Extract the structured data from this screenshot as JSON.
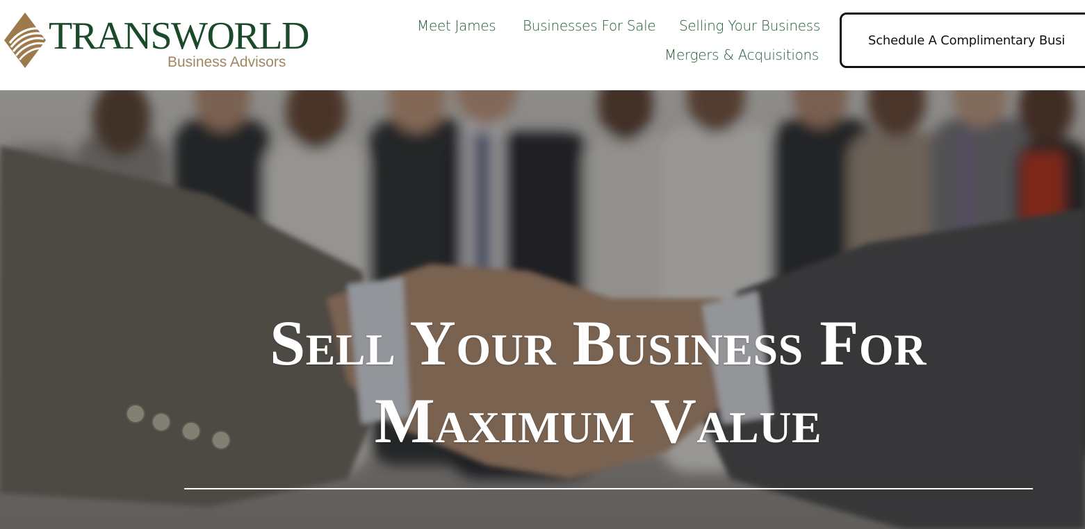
{
  "header": {
    "logo": {
      "wordmark": "TRANSWORLD",
      "tagline": "Business Advisors",
      "icon": "diamond-swoosh-logo-icon",
      "colors": {
        "wordmark": "#1b4a2b",
        "tagline": "#a08760",
        "icon": "#9c7a4c"
      }
    },
    "nav": {
      "items": [
        {
          "label": "Meet James"
        },
        {
          "label": "Businesses For Sale"
        },
        {
          "label": "Selling Your Business"
        },
        {
          "label": "Mergers & Acquisitions"
        }
      ],
      "color": "#1f5c34"
    },
    "cta": {
      "label": "Schedule A Complimentary Busi"
    }
  },
  "hero": {
    "title_lines": [
      "Sell Your Business For",
      "Maximum Value"
    ],
    "background": "business-handshake-photo"
  }
}
